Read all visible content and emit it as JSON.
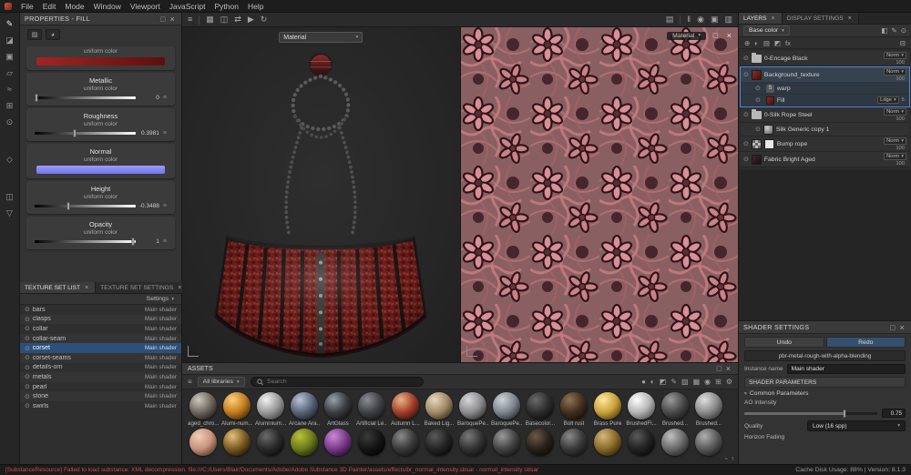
{
  "menubar": {
    "items": [
      "File",
      "Edit",
      "Mode",
      "Window",
      "Viewport",
      "JavaScript",
      "Python",
      "Help"
    ]
  },
  "properties": {
    "title": "PROPERTIES - FILL",
    "base": {
      "sub": "uniform color"
    },
    "metallic": {
      "title": "Metallic",
      "sub": "uniform color",
      "value": "0"
    },
    "roughness": {
      "title": "Roughness",
      "sub": "uniform color",
      "value": "0.3981"
    },
    "normal": {
      "title": "Normal",
      "sub": "uniform color"
    },
    "height": {
      "title": "Height",
      "sub": "uniform color",
      "value": "-0.3488"
    },
    "opacity": {
      "title": "Opacity",
      "sub": "uniform color",
      "value": "1"
    },
    "base_color": "#8f1d1a",
    "normal_color": "#8587f6"
  },
  "texture_sets": {
    "tab_list": "TEXTURE SET LIST",
    "tab_settings": "TEXTURE SET SETTINGS",
    "settings_label": "Settings",
    "items": [
      {
        "name": "bars",
        "shader": "Main shader"
      },
      {
        "name": "clasps",
        "shader": "Main shader"
      },
      {
        "name": "collar",
        "shader": "Main shader"
      },
      {
        "name": "collar-seam",
        "shader": "Main shader"
      },
      {
        "name": "corset",
        "shader": "Main shader",
        "selected": true
      },
      {
        "name": "corset-seams",
        "shader": "Main shader"
      },
      {
        "name": "details-orn",
        "shader": "Main shader"
      },
      {
        "name": "metals",
        "shader": "Main shader"
      },
      {
        "name": "pearl",
        "shader": "Main shader"
      },
      {
        "name": "stone",
        "shader": "Main shader"
      },
      {
        "name": "swirls",
        "shader": "Main shader"
      }
    ]
  },
  "viewport3d": {
    "material_dropdown": "Material"
  },
  "viewport2d": {
    "badge": "Material"
  },
  "assets": {
    "title": "ASSETS",
    "library_label": "All libraries",
    "search_placeholder": "Search",
    "materials": [
      {
        "name": "aged_chro...",
        "colors": [
          "#cfc8bd",
          "#6e675e",
          "#1a1713"
        ]
      },
      {
        "name": "Alumi-num...",
        "colors": [
          "#ffd27a",
          "#c27c22",
          "#3a2306"
        ]
      },
      {
        "name": "Aluminium...",
        "colors": [
          "#f2f2f2",
          "#9a9a9a",
          "#3c3c3c"
        ]
      },
      {
        "name": "Arcane Ara...",
        "colors": [
          "#b9c2d6",
          "#5a6478",
          "#181c26"
        ]
      },
      {
        "name": "ArtGlass",
        "colors": [
          "#9aa0a8",
          "#3a3e44",
          "#0c0d10"
        ]
      },
      {
        "name": "Artificial Le...",
        "colors": [
          "#8a8d92",
          "#3f4145",
          "#121315"
        ]
      },
      {
        "name": "Autumn L...",
        "colors": [
          "#e8b48a",
          "#a33f28",
          "#2a0d08"
        ]
      },
      {
        "name": "Baked Lig...",
        "colors": [
          "#e8d7bd",
          "#a08a67",
          "#30271a"
        ]
      },
      {
        "name": "BaroquePe...",
        "colors": [
          "#d8d8da",
          "#8c8c90",
          "#2a2a2c"
        ]
      },
      {
        "name": "BaroquePe...",
        "colors": [
          "#cfd4da",
          "#7f858e",
          "#23262a"
        ]
      },
      {
        "name": "Basecolor...",
        "colors": [
          "#6a6a6a",
          "#2e2e2e",
          "#0a0a0a"
        ]
      },
      {
        "name": "Bolt rust",
        "colors": [
          "#8f7355",
          "#43301f",
          "#100b06"
        ]
      },
      {
        "name": "Brass Pure",
        "colors": [
          "#ffe9a0",
          "#c9a23c",
          "#4a3408"
        ]
      },
      {
        "name": "BrushedFl...",
        "colors": [
          "#ffffff",
          "#b5b5b5",
          "#4a4a4a"
        ]
      },
      {
        "name": "Brushed...",
        "colors": [
          "#9a9a9a",
          "#4a4a4a",
          "#141414"
        ]
      },
      {
        "name": "Brushed...",
        "colors": [
          "#e0e0e0",
          "#8a8a8a",
          "#2e2e2e"
        ]
      }
    ],
    "materials_row2": [
      {
        "colors": [
          "#f2cdb6",
          "#c9937e",
          "#4a2e22"
        ]
      },
      {
        "colors": [
          "#e8c07a",
          "#7a5a20",
          "#1a1206"
        ]
      },
      {
        "colors": [
          "#6a6a6a",
          "#2a2a2a",
          "#080808"
        ]
      },
      {
        "colors": [
          "#b8c23a",
          "#6a7a1a",
          "#1a2006"
        ]
      },
      {
        "colors": [
          "#c98ad4",
          "#7a3a8a",
          "#200a26"
        ]
      },
      {
        "colors": [
          "#3a3a3a",
          "#151515",
          "#000000"
        ]
      },
      {
        "colors": [
          "#8a8a8a",
          "#3a3a3a",
          "#101010"
        ]
      },
      {
        "colors": [
          "#5a5a5a",
          "#242424",
          "#060606"
        ]
      },
      {
        "colors": [
          "#7a7a7a",
          "#333333",
          "#0c0c0c"
        ]
      },
      {
        "colors": [
          "#9a9a9a",
          "#444444",
          "#111111"
        ]
      },
      {
        "colors": [
          "#6a5a4a",
          "#2a2218",
          "#0a0806"
        ]
      },
      {
        "colors": [
          "#8a8a8a",
          "#3a3a3a",
          "#101010"
        ]
      },
      {
        "colors": [
          "#d4b87a",
          "#8a6a2a",
          "#2a1c06"
        ]
      },
      {
        "colors": [
          "#5a5a5a",
          "#222222",
          "#060606"
        ]
      },
      {
        "colors": [
          "#c0c0c0",
          "#6a6a6a",
          "#1e1e1e"
        ]
      },
      {
        "colors": [
          "#b0b0b0",
          "#5a5a5a",
          "#181818"
        ]
      }
    ]
  },
  "layers": {
    "tab_layers": "LAYERS",
    "tab_display": "DISPLAY SETTINGS",
    "channel": "Base color",
    "rows": {
      "r0": {
        "name": "0-Encage Black",
        "blend": "Norm",
        "opacity": "100"
      },
      "r1": {
        "name": "Background_texture",
        "blend": "Norm",
        "opacity": "100"
      },
      "r1a": {
        "name": "warp",
        "badge": "S"
      },
      "r1b": {
        "name": "Fill",
        "blend": "Ldge",
        "opacity": "5"
      },
      "r2": {
        "name": "0-Silk Rope Steel",
        "blend": "Norm",
        "opacity": "100"
      },
      "r3": {
        "name": "Silk Generic copy 1"
      },
      "r4": {
        "name": "Bump rope",
        "blend": "Norm",
        "opacity": "100"
      },
      "r5": {
        "name": "Fabric Bright Aged",
        "blend": "Norm",
        "opacity": "100"
      }
    }
  },
  "shader": {
    "title": "SHADER SETTINGS",
    "undo": "Undo",
    "redo": "Redo",
    "shader_name": "pbr-metal-rough-with-alpha-blending",
    "instance_label": "Instance name",
    "instance_value": "Main shader",
    "params_title": "SHADER PARAMETERS",
    "group": "Common Parameters",
    "ao_label": "AO Intensity",
    "ao_value": "0.75",
    "quality_label": "Quality",
    "quality_value": "Low (16 spp)",
    "horizon_label": "Horizon Fading"
  },
  "statusbar": {
    "error": "[SubstanceResource] Failed to load substance: XML decompression. file:///C:/Users/Blair/Documents/Adobe/Adobe Substance 3D Painter/assets/effects/br_normal_intensity.sbsar - normal_intensity sbsar",
    "right": "Cache Disk Usage: 88% | Version: 8.1.3"
  }
}
